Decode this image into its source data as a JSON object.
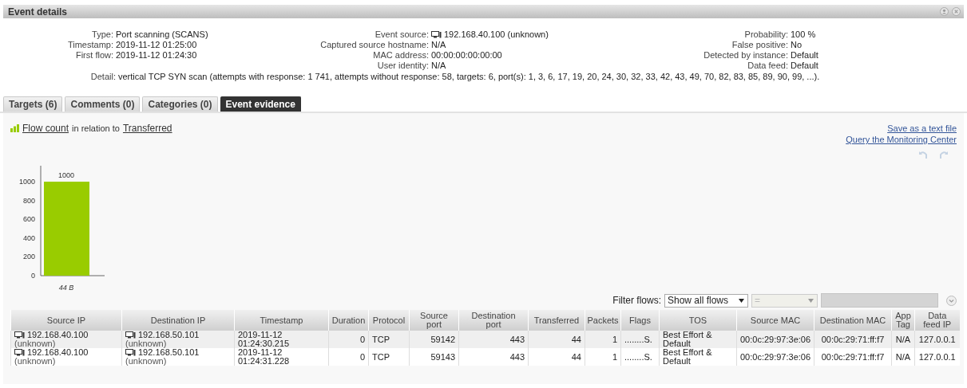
{
  "window": {
    "title": "Event details"
  },
  "details": [
    [
      {
        "label": "Type:",
        "value": "Port scanning (SCANS)",
        "kind": "text"
      },
      {
        "label": "Timestamp:",
        "value": "2019-11-12 01:25:00",
        "kind": "text"
      },
      {
        "label": "First flow:",
        "value": "2019-11-12 01:24:30",
        "kind": "text"
      }
    ],
    [
      {
        "label": "Event source:",
        "value": "192.168.40.100 (unknown)",
        "kind": "host"
      },
      {
        "label": "Captured source hostname:",
        "value": "N/A",
        "kind": "text"
      },
      {
        "label": "MAC address:",
        "value": "00:00:00:00:00:00",
        "kind": "text"
      },
      {
        "label": "User identity:",
        "value": "N/A",
        "kind": "text"
      }
    ],
    [
      {
        "label": "Probability:",
        "value": "100 %",
        "kind": "text"
      },
      {
        "label": "False positive:",
        "value": "No",
        "kind": "text"
      },
      {
        "label": "Detected by instance:",
        "value": "Default",
        "kind": "text"
      },
      {
        "label": "Data feed:",
        "value": "Default",
        "kind": "text"
      }
    ]
  ],
  "detail": {
    "label": "Detail:",
    "value": "vertical TCP SYN scan (attempts with response: 1 741, attempts without response: 58, targets: 6, port(s): 1, 3, 6, 17, 19, 20, 24, 30, 32, 33, 42, 43, 49, 70, 82, 83, 85, 89, 90, 99, ...)."
  },
  "tabs": [
    {
      "label": "Targets (6)",
      "selected": false
    },
    {
      "label": "Comments (0)",
      "selected": false
    },
    {
      "label": "Categories (0)",
      "selected": false
    },
    {
      "label": "Event evidence",
      "selected": true
    }
  ],
  "evidence": {
    "metric": "Flow count",
    "relation": "in relation to",
    "dimension": "Transferred",
    "links": [
      "Save as a text file",
      "Query the Monitoring Center"
    ],
    "chart_data": {
      "type": "bar",
      "categories": [
        "44 B"
      ],
      "series": [
        {
          "color": "#99cc00",
          "values": [
            1000
          ]
        }
      ],
      "ylim": [
        0,
        1170
      ],
      "yticks": [
        0,
        200,
        400,
        600,
        800,
        1000
      ],
      "data_labels": true,
      "value_labels": [
        "1000"
      ]
    }
  },
  "filter": {
    "label": "Filter flows:",
    "mode": "Show all flows",
    "operator": "="
  },
  "table": {
    "columns": [
      [
        "Source IP"
      ],
      [
        "Destination IP"
      ],
      [
        "Timestamp"
      ],
      [
        "Duration"
      ],
      [
        "Protocol"
      ],
      [
        "Source",
        "port"
      ],
      [
        "Destination",
        "port"
      ],
      [
        "Transferred"
      ],
      [
        "Packets"
      ],
      [
        "Flags"
      ],
      [
        "TOS"
      ],
      [
        "Source MAC"
      ],
      [
        "Destination MAC"
      ],
      [
        "App",
        "Tag"
      ],
      [
        "Data",
        "feed IP"
      ]
    ],
    "rows": [
      {
        "source_ip": "192.168.40.100",
        "source_name": "(unknown)",
        "dest_ip": "192.168.50.101",
        "dest_name": "(unknown)",
        "timestamp": [
          "2019-11-12",
          "01:24:30.215"
        ],
        "duration": "0",
        "protocol": "TCP",
        "source_port": "59142",
        "dest_port": "443",
        "transferred": "44",
        "packets": "1",
        "flags": "........S.",
        "tos": [
          "Best Effort &",
          "Default"
        ],
        "source_mac": "00:0c:29:97:3e:06",
        "dest_mac": "00:0c:29:71:ff:f7",
        "app_tag": "N/A",
        "data_feed_ip": "127.0.0.1"
      },
      {
        "source_ip": "192.168.40.100",
        "source_name": "(unknown)",
        "dest_ip": "192.168.50.101",
        "dest_name": "(unknown)",
        "timestamp": [
          "2019-11-12",
          "01:24:31.228"
        ],
        "duration": "0",
        "protocol": "TCP",
        "source_port": "59143",
        "dest_port": "443",
        "transferred": "44",
        "packets": "1",
        "flags": "........S.",
        "tos": [
          "Best Effort &",
          "Default"
        ],
        "source_mac": "00:0c:29:97:3e:06",
        "dest_mac": "00:0c:29:71:ff:f7",
        "app_tag": "N/A",
        "data_feed_ip": "127.0.0.1"
      }
    ]
  }
}
